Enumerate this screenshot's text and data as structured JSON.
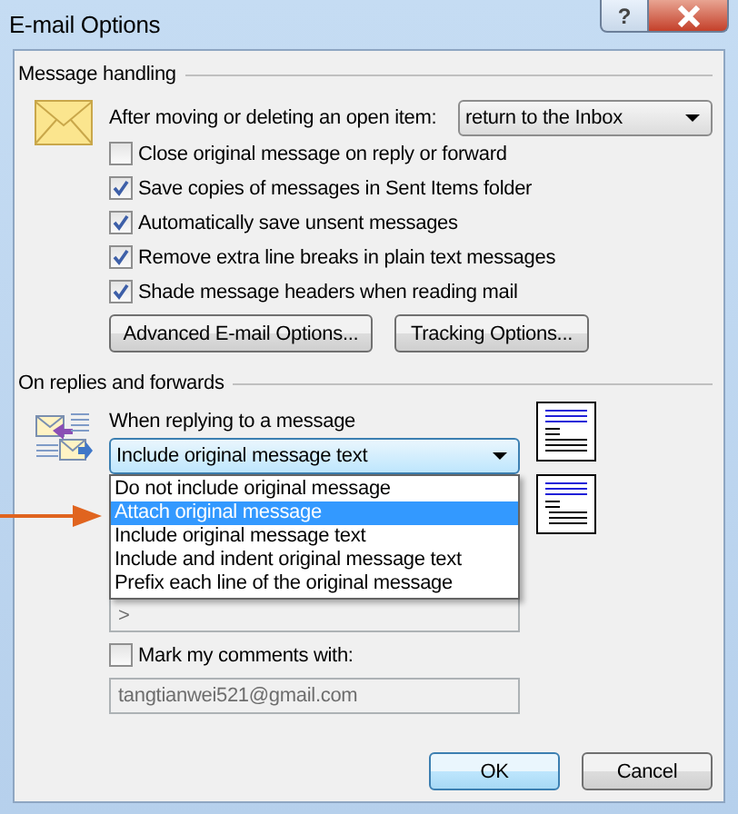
{
  "window": {
    "title": "E-mail Options",
    "help": "?"
  },
  "message_handling": {
    "title": "Message handling",
    "after_moving": {
      "label": "After moving or deleting an open item:",
      "value": "return to the Inbox"
    },
    "options": [
      {
        "label": "Close original message on reply or forward",
        "checked": false
      },
      {
        "label": "Save copies of messages in Sent Items folder",
        "checked": true
      },
      {
        "label": "Automatically save unsent messages",
        "checked": true
      },
      {
        "label": "Remove extra line breaks in plain text messages",
        "checked": true
      },
      {
        "label": "Shade message headers when reading mail",
        "checked": true
      }
    ],
    "buttons": [
      "Advanced E-mail Options...",
      "Tracking Options..."
    ]
  },
  "replies": {
    "title": "On replies and forwards",
    "when_replying": {
      "label": "When replying to a message",
      "value": "Include original message text",
      "expanded": true
    },
    "dropdown_list": [
      {
        "label": "Do not include original message",
        "selected": false
      },
      {
        "label": "Attach original message",
        "selected": true
      },
      {
        "label": "Include original message text",
        "selected": false
      },
      {
        "label": "Include and indent original message text",
        "selected": false
      },
      {
        "label": "Prefix each line of the original message",
        "selected": false
      }
    ],
    "prefix_field": {
      "value": ">",
      "disabled": true
    },
    "mark_comments": {
      "label": "Mark my comments with:",
      "checked": false
    },
    "mark_field": {
      "value": "tangtianwei521@gmail.com",
      "disabled": true
    }
  },
  "buttons": [
    {
      "label": "OK",
      "default": true
    },
    {
      "label": "Cancel",
      "default": false
    }
  ]
}
